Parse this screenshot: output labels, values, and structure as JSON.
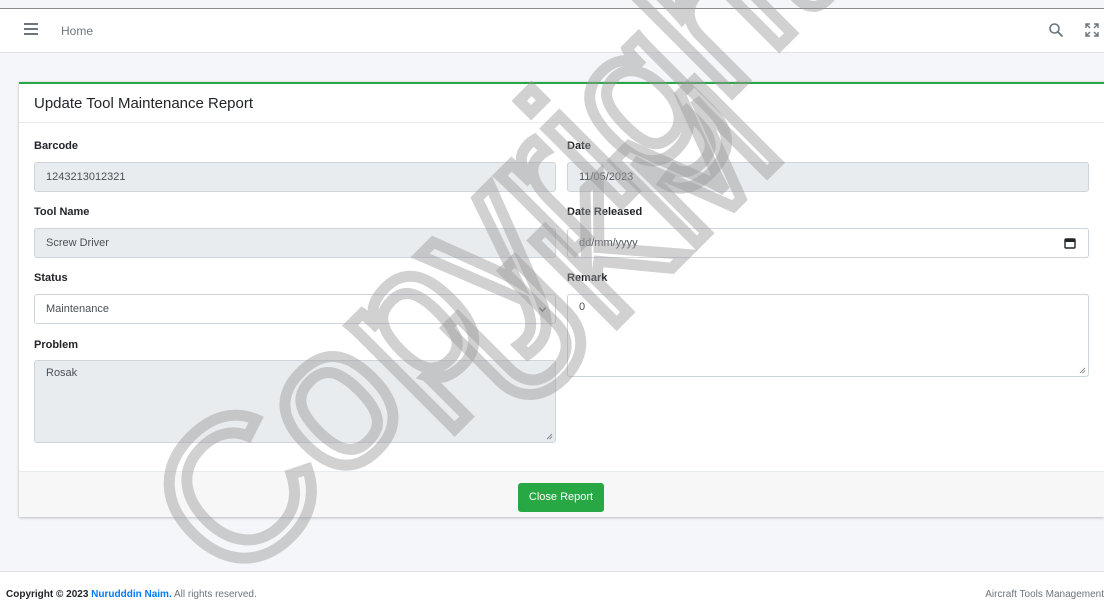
{
  "navbar": {
    "home_label": "Home",
    "icons": [
      "hamburger-menu-icon",
      "search-icon",
      "fullscreen-icon"
    ]
  },
  "card": {
    "title": "Update Tool Maintenance Report",
    "accent_color": "#28a745",
    "fields": {
      "barcode": {
        "label": "Barcode",
        "value": "1243213012321"
      },
      "date": {
        "label": "Date",
        "value": "11/05/2023"
      },
      "tool_name": {
        "label": "Tool Name",
        "value": "Screw Driver"
      },
      "date_released": {
        "label": "Date Released",
        "placeholder": "dd/mm/yyyy"
      },
      "status": {
        "label": "Status",
        "selected": "Maintenance"
      },
      "remark": {
        "label": "Remark",
        "value": "0"
      },
      "problem": {
        "label": "Problem",
        "value": "Rosak"
      }
    },
    "close_button_label": "Close Report"
  },
  "footer": {
    "copyright_prefix": "Copyright © 2023",
    "author": "Nurudddin Naim.",
    "rights": "All rights reserved.",
    "app_name": "Aircraft Tools Management"
  },
  "watermark": {
    "line1": "Copyright@",
    "line2": "UKM"
  }
}
